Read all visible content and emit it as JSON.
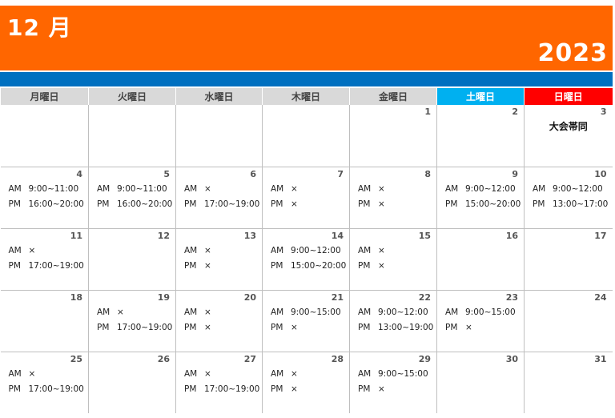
{
  "header": {
    "month": "12 月",
    "year": "2023"
  },
  "weekdays": [
    "月曜日",
    "火曜日",
    "水曜日",
    "木曜日",
    "金曜日",
    "土曜日",
    "日曜日"
  ],
  "labels": {
    "am": "AM",
    "pm": "PM"
  },
  "colors": {
    "header": "#ff6600",
    "bar": "#0070c0",
    "saturday": "#00b0f0",
    "sunday": "#ff0000",
    "weekday_header": "#d9d9d9"
  },
  "weeks": [
    [
      {
        "day": ""
      },
      {
        "day": ""
      },
      {
        "day": ""
      },
      {
        "day": ""
      },
      {
        "day": "1"
      },
      {
        "day": "2"
      },
      {
        "day": "3",
        "event": "大会帯同"
      }
    ],
    [
      {
        "day": "4",
        "am": "9:00~11:00",
        "pm": "16:00~20:00"
      },
      {
        "day": "5",
        "am": "9:00~11:00",
        "pm": "16:00~20:00"
      },
      {
        "day": "6",
        "am": "×",
        "pm": "17:00~19:00"
      },
      {
        "day": "7",
        "am": "×",
        "pm": "×"
      },
      {
        "day": "8",
        "am": "×",
        "pm": "×"
      },
      {
        "day": "9",
        "am": "9:00~12:00",
        "pm": "15:00~20:00"
      },
      {
        "day": "10",
        "am": "9:00~12:00",
        "pm": "13:00~17:00"
      }
    ],
    [
      {
        "day": "11",
        "am": "×",
        "pm": "17:00~19:00"
      },
      {
        "day": "12"
      },
      {
        "day": "13",
        "am": "×",
        "pm": "×"
      },
      {
        "day": "14",
        "am": "9:00~12:00",
        "pm": "15:00~20:00"
      },
      {
        "day": "15",
        "am": "×",
        "pm": "×"
      },
      {
        "day": "16"
      },
      {
        "day": "17"
      }
    ],
    [
      {
        "day": "18"
      },
      {
        "day": "19",
        "am": "×",
        "pm": "17:00~19:00"
      },
      {
        "day": "20",
        "am": "×",
        "pm": "×"
      },
      {
        "day": "21",
        "am": "9:00~15:00",
        "pm": "×"
      },
      {
        "day": "22",
        "am": "9:00~12:00",
        "pm": "13:00~19:00"
      },
      {
        "day": "23",
        "am": "9:00~15:00",
        "pm": "×"
      },
      {
        "day": "24"
      }
    ],
    [
      {
        "day": "25",
        "am": "×",
        "pm": "17:00~19:00"
      },
      {
        "day": "26"
      },
      {
        "day": "27",
        "am": "×",
        "pm": "17:00~19:00"
      },
      {
        "day": "28",
        "am": "×",
        "pm": "×"
      },
      {
        "day": "29",
        "am": "9:00~15:00",
        "pm": "×"
      },
      {
        "day": "30"
      },
      {
        "day": "31"
      }
    ]
  ]
}
